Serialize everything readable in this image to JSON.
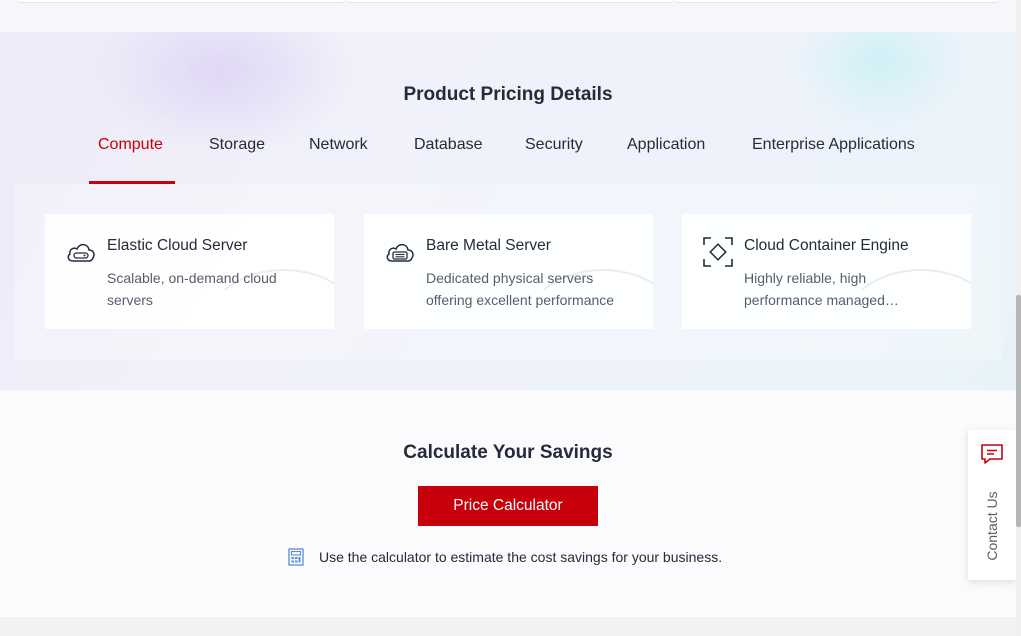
{
  "pricing": {
    "title": "Product Pricing Details",
    "tabs": [
      {
        "label": "Compute",
        "active": true
      },
      {
        "label": "Storage",
        "active": false
      },
      {
        "label": "Network",
        "active": false
      },
      {
        "label": "Database",
        "active": false
      },
      {
        "label": "Security",
        "active": false
      },
      {
        "label": "Application",
        "active": false
      },
      {
        "label": "Enterprise Applications",
        "active": false
      }
    ],
    "cards": [
      {
        "title": "Elastic Cloud Server",
        "description": "Scalable, on-demand cloud servers",
        "icon": "cloud-server-icon"
      },
      {
        "title": "Bare Metal Server",
        "description": "Dedicated physical servers offering excellent performance",
        "icon": "bare-metal-server-icon"
      },
      {
        "title": "Cloud Container Engine",
        "description": "Highly reliable, high performance managed Kubernetes",
        "icon": "container-engine-icon"
      }
    ]
  },
  "savings": {
    "title": "Calculate Your Savings",
    "button_label": "Price Calculator",
    "note": "Use the calculator to estimate the cost savings for your business.",
    "note_icon": "calculator-icon"
  },
  "contact": {
    "label": "Contact Us",
    "icon": "chat-icon"
  },
  "colors": {
    "accent": "#c7000b",
    "text": "#252b3a",
    "muted_text": "#575d6c"
  }
}
